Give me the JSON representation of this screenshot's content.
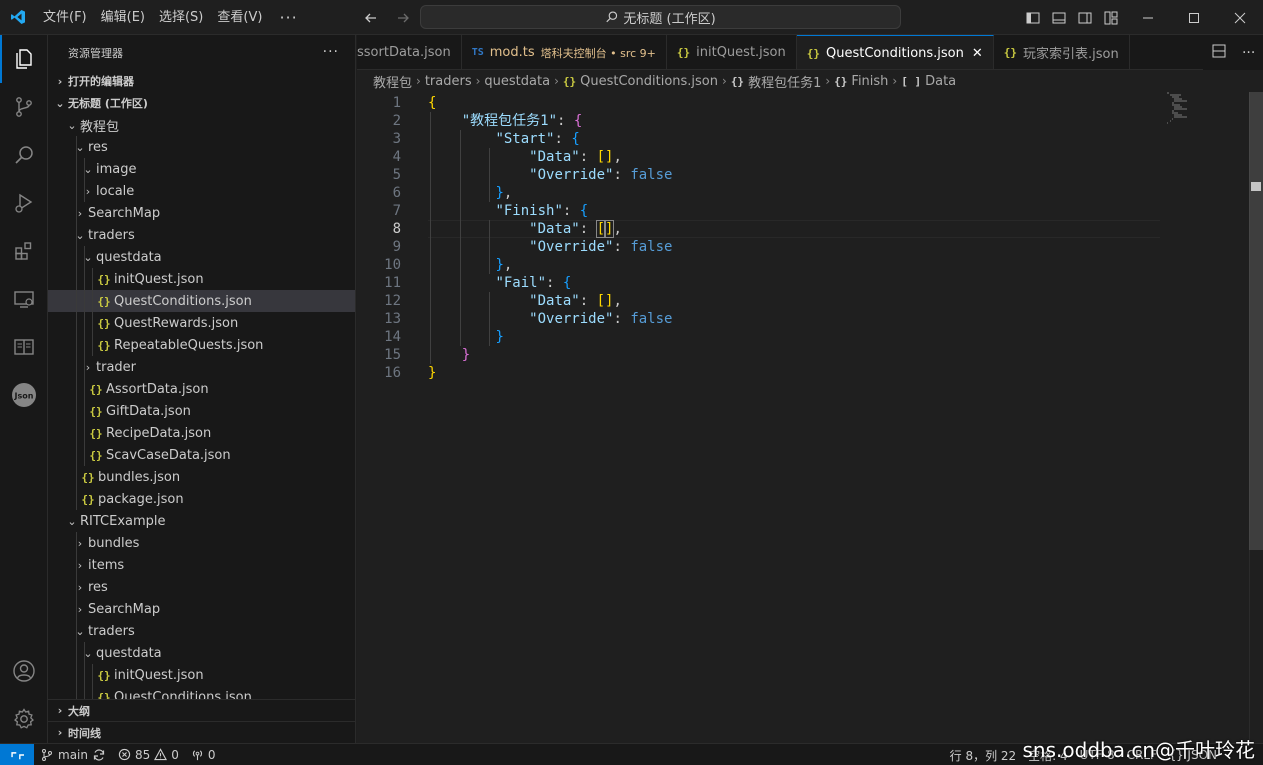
{
  "titlebar": {
    "menus": [
      "文件(F)",
      "编辑(E)",
      "选择(S)",
      "查看(V)"
    ],
    "more": "···",
    "command_center": "无标题 (工作区)"
  },
  "sidebar": {
    "title": "资源管理器",
    "more": "···",
    "open_editors": "打开的编辑器",
    "workspace": "无标题 (工作区)",
    "tree": [
      {
        "label": "教程包",
        "depth": 0,
        "type": "folder",
        "open": true
      },
      {
        "label": "res",
        "depth": 1,
        "type": "folder",
        "open": true
      },
      {
        "label": "image",
        "depth": 2,
        "type": "folder",
        "open": true
      },
      {
        "label": "locale",
        "depth": 2,
        "type": "folder",
        "open": false
      },
      {
        "label": "SearchMap",
        "depth": 1,
        "type": "folder",
        "open": false
      },
      {
        "label": "traders",
        "depth": 1,
        "type": "folder",
        "open": true
      },
      {
        "label": "questdata",
        "depth": 2,
        "type": "folder",
        "open": true
      },
      {
        "label": "initQuest.json",
        "depth": 3,
        "type": "json"
      },
      {
        "label": "QuestConditions.json",
        "depth": 3,
        "type": "json",
        "selected": true
      },
      {
        "label": "QuestRewards.json",
        "depth": 3,
        "type": "json"
      },
      {
        "label": "RepeatableQuests.json",
        "depth": 3,
        "type": "json"
      },
      {
        "label": "trader",
        "depth": 2,
        "type": "folder",
        "open": false
      },
      {
        "label": "AssortData.json",
        "depth": 2,
        "type": "json"
      },
      {
        "label": "GiftData.json",
        "depth": 2,
        "type": "json"
      },
      {
        "label": "RecipeData.json",
        "depth": 2,
        "type": "json"
      },
      {
        "label": "ScavCaseData.json",
        "depth": 2,
        "type": "json"
      },
      {
        "label": "bundles.json",
        "depth": 1,
        "type": "json"
      },
      {
        "label": "package.json",
        "depth": 1,
        "type": "json"
      },
      {
        "label": "RITCExample",
        "depth": 0,
        "type": "folder",
        "open": true
      },
      {
        "label": "bundles",
        "depth": 1,
        "type": "folder",
        "open": false
      },
      {
        "label": "items",
        "depth": 1,
        "type": "folder",
        "open": false
      },
      {
        "label": "res",
        "depth": 1,
        "type": "folder",
        "open": false
      },
      {
        "label": "SearchMap",
        "depth": 1,
        "type": "folder",
        "open": false
      },
      {
        "label": "traders",
        "depth": 1,
        "type": "folder",
        "open": true
      },
      {
        "label": "questdata",
        "depth": 2,
        "type": "folder",
        "open": true
      },
      {
        "label": "initQuest.json",
        "depth": 3,
        "type": "json"
      },
      {
        "label": "QuestConditions.json",
        "depth": 3,
        "type": "json"
      }
    ],
    "outline": "大纲",
    "timeline": "时间线"
  },
  "tabs": [
    {
      "label": "ssortData.json",
      "icon": "json",
      "active": false
    },
    {
      "label": "mod.ts",
      "icon": "ts",
      "sub": "塔科夫控制台 • src 9+",
      "modified": true,
      "active": false
    },
    {
      "label": "initQuest.json",
      "icon": "json",
      "active": false
    },
    {
      "label": "QuestConditions.json",
      "icon": "json",
      "active": true,
      "close": "✕"
    },
    {
      "label": "玩家索引表.json",
      "icon": "json",
      "active": false
    }
  ],
  "breadcrumb": [
    "教程包",
    "traders",
    "questdata",
    "QuestConditions.json",
    "教程包任务1",
    "Finish",
    "Data"
  ],
  "editor": {
    "current_line": 8,
    "lines": [
      "{",
      "    \"教程包任务1\": {",
      "        \"Start\": {",
      "            \"Data\": [],",
      "            \"Override\": false",
      "        },",
      "        \"Finish\": {",
      "            \"Data\": [],",
      "            \"Override\": false",
      "        },",
      "        \"Fail\": {",
      "            \"Data\": [],",
      "            \"Override\": false",
      "        }",
      "    }",
      "}"
    ]
  },
  "statusbar": {
    "branch": "main",
    "errors": "85",
    "warnings": "0",
    "ports": "0",
    "position": "行 8，列 22",
    "indent": "空格: 4",
    "encoding": "UTF-8",
    "eol": "CRLF",
    "language": "JSON"
  },
  "watermark": "sns.oddba.cn@千叶玲花",
  "colors": {
    "accent": "#0078d4",
    "json_icon": "#cbcb41",
    "key": "#9cdcfe",
    "keyword": "#569cd6",
    "bracket_1": "#ffd700",
    "bracket_2": "#da70d6",
    "bracket_3": "#179fff"
  }
}
